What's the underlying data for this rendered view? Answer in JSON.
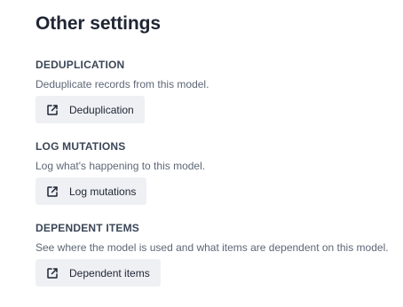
{
  "title": "Other settings",
  "sections": [
    {
      "heading": "DEDUPLICATION",
      "description": "Deduplicate records from this model.",
      "button_label": "Deduplication",
      "button_icon": "external-link-icon"
    },
    {
      "heading": "LOG MUTATIONS",
      "description": "Log what's happening to this model.",
      "button_label": "Log mutations",
      "button_icon": "external-link-icon"
    },
    {
      "heading": "DEPENDENT ITEMS",
      "description": "See where the model is used and what items are dependent on this model.",
      "button_label": "Dependent items",
      "button_icon": "external-link-icon"
    }
  ],
  "colors": {
    "title": "#1f2533",
    "heading": "#3b4657",
    "description": "#5d6776",
    "button_bg": "#eef0f4"
  }
}
